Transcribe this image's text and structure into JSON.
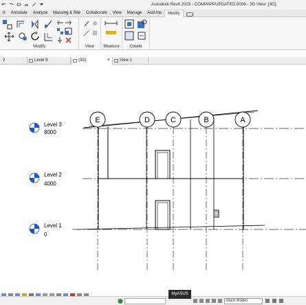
{
  "titlebar": {
    "title": "Autodesk Revit 2023 - COMPAPPUPDATED.0006 - 3D View: {3D}"
  },
  "ribbon": {
    "tabs": [
      "rt",
      "Annotate",
      "Analyze",
      "Massing & Site",
      "Collaborate",
      "View",
      "Manage",
      "Add-Ins",
      "Modify"
    ],
    "active_tab": "Modify",
    "panels": [
      {
        "label": "Modify"
      },
      {
        "label": "View"
      },
      {
        "label": "Measure"
      },
      {
        "label": "Create"
      }
    ]
  },
  "view_tabs": [
    {
      "label": "2"
    },
    {
      "label": "Level 3"
    },
    {
      "label": "{3D}",
      "close": "×"
    },
    {
      "label": "View 1"
    }
  ],
  "drawing": {
    "grids": [
      "E",
      "D",
      "C",
      "B",
      "A"
    ],
    "levels": [
      {
        "name": "Level 3",
        "elevation": "8000"
      },
      {
        "name": "Level 2",
        "elevation": "4000"
      },
      {
        "name": "Level 1",
        "elevation": "0"
      }
    ]
  },
  "tooltip": "MyASUS",
  "statusbar": {
    "model": "Main Model"
  },
  "colors": {
    "level_head_blue": "#1f57c9",
    "line": "#000000",
    "grid_dash": "#333333"
  }
}
